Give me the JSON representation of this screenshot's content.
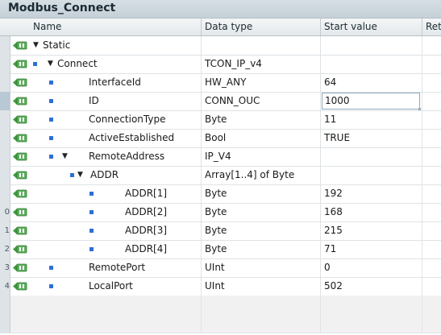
{
  "window": {
    "title": "Modbus_Connect"
  },
  "columns": {
    "name": "Name",
    "data_type": "Data type",
    "start_value": "Start value",
    "retain": "Ret"
  },
  "rows": [
    {
      "num": "",
      "name": "Static",
      "type": "",
      "value": "",
      "level": 0,
      "toggle": "expanded",
      "bullet": false
    },
    {
      "num": "",
      "name": "Connect",
      "type": "TCON_IP_v4",
      "value": "",
      "level": 1,
      "toggle": "expanded",
      "bullet": true
    },
    {
      "num": "",
      "name": "InterfaceId",
      "type": "HW_ANY",
      "value": "64",
      "level": 2,
      "toggle": "",
      "bullet": true
    },
    {
      "num": "",
      "name": "ID",
      "type": "CONN_OUC",
      "value": "1000",
      "level": 2,
      "toggle": "",
      "bullet": true,
      "editing": true
    },
    {
      "num": "",
      "name": "ConnectionType",
      "type": "Byte",
      "value": "11",
      "level": 2,
      "toggle": "",
      "bullet": true
    },
    {
      "num": "",
      "name": "ActiveEstablished",
      "type": "Bool",
      "value": "TRUE",
      "level": 2,
      "toggle": "",
      "bullet": true
    },
    {
      "num": "",
      "name": "RemoteAddress",
      "type": "IP_V4",
      "value": "",
      "level": 2,
      "toggle": "expanded",
      "bullet": true
    },
    {
      "num": "",
      "name": "ADDR",
      "type": "Array[1..4] of Byte",
      "value": "",
      "level": 3,
      "toggle": "expanded",
      "bullet": true
    },
    {
      "num": "",
      "name": "ADDR[1]",
      "type": "Byte",
      "value": "192",
      "level": 4,
      "toggle": "",
      "bullet": true
    },
    {
      "num": "0",
      "name": "ADDR[2]",
      "type": "Byte",
      "value": "168",
      "level": 4,
      "toggle": "",
      "bullet": true
    },
    {
      "num": "1",
      "name": "ADDR[3]",
      "type": "Byte",
      "value": "215",
      "level": 4,
      "toggle": "",
      "bullet": true
    },
    {
      "num": "2",
      "name": "ADDR[4]",
      "type": "Byte",
      "value": "71",
      "level": 4,
      "toggle": "",
      "bullet": true
    },
    {
      "num": "3",
      "name": "RemotePort",
      "type": "UInt",
      "value": "0",
      "level": 2,
      "toggle": "",
      "bullet": true
    },
    {
      "num": "4",
      "name": "LocalPort",
      "type": "UInt",
      "value": "502",
      "level": 2,
      "toggle": "",
      "bullet": true
    },
    {
      "num": "",
      "name": "",
      "type": "",
      "value": "",
      "level": 0,
      "toggle": "",
      "bullet": false,
      "empty": true
    },
    {
      "num": "",
      "name": "",
      "type": "",
      "value": "",
      "level": 0,
      "toggle": "",
      "bullet": false,
      "empty": true
    }
  ],
  "icons": {
    "io": "in-out-interface-icon",
    "expand": "expand-triangle-icon",
    "bullet": "member-bullet-icon"
  },
  "colors": {
    "bullet": "#2e6fd6",
    "header_bg": "#d6dfe4",
    "alt_row": "#f1f1f1"
  }
}
